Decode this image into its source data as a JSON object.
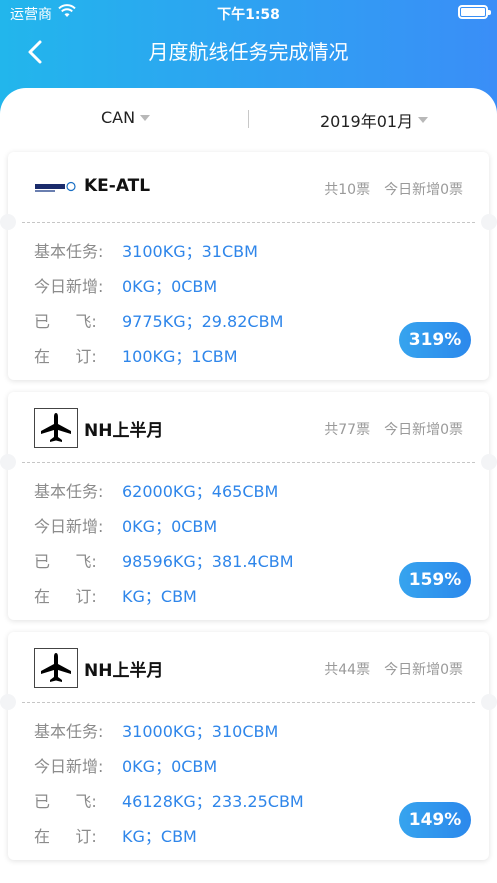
{
  "status_bar": {
    "carrier": "运营商",
    "time": "下午1:58"
  },
  "header": {
    "title": "月度航线任务完成情况"
  },
  "filters": {
    "airport": "CAN",
    "month": "2019年01月"
  },
  "labels": {
    "basic_task": "基本任务:",
    "today_new": "今日新增:",
    "flown": "已     飞:",
    "booked": "在     订:"
  },
  "cards": [
    {
      "logo": "korean-air-logo",
      "route": "KE-ATL",
      "total": "共10票",
      "today": "今日新增0票",
      "basic_task": "3100KG；31CBM",
      "today_new": "0KG；0CBM",
      "flown": "9775KG；29.82CBM",
      "booked": "100KG；1CBM",
      "percent": "319%"
    },
    {
      "logo": "airplane-icon",
      "route": "NH上半月",
      "total": "共77票",
      "today": "今日新增0票",
      "basic_task": "62000KG；465CBM",
      "today_new": "0KG；0CBM",
      "flown": "98596KG；381.4CBM",
      "booked": "KG；CBM",
      "percent": "159%"
    },
    {
      "logo": "airplane-icon",
      "route": "NH上半月",
      "total": "共44票",
      "today": "今日新增0票",
      "basic_task": "31000KG；310CBM",
      "today_new": "0KG；0CBM",
      "flown": "46128KG；233.25CBM",
      "booked": "KG；CBM",
      "percent": "149%"
    }
  ]
}
